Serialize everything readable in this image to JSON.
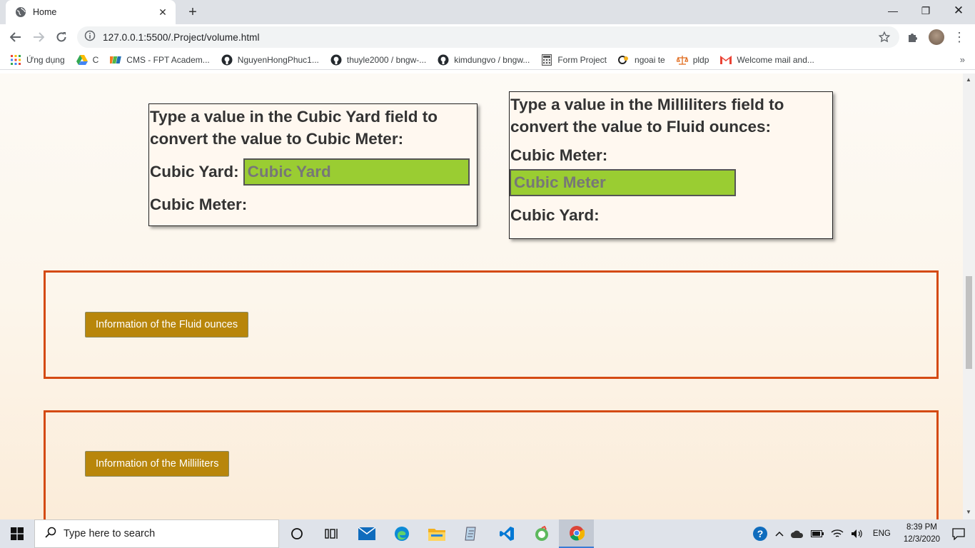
{
  "browser": {
    "tab_title": "Home",
    "url": "127.0.0.1:5500/.Project/volume.html",
    "bookmarks": [
      {
        "label": "Ứng dụng",
        "icon": "apps-grid-icon"
      },
      {
        "label": "C",
        "icon": "google-drive-icon"
      },
      {
        "label": "CMS - FPT Academ...",
        "icon": "fpt-icon"
      },
      {
        "label": "NguyenHongPhuc1...",
        "icon": "github-icon"
      },
      {
        "label": "thuyle2000 / bngw-...",
        "icon": "github-icon"
      },
      {
        "label": "kimdungvo / bngw...",
        "icon": "github-icon"
      },
      {
        "label": "Form Project",
        "icon": "calculator-icon"
      },
      {
        "label": "ngoai te",
        "icon": "currency-icon"
      },
      {
        "label": "pldp",
        "icon": "scale-icon"
      },
      {
        "label": "Welcome mail and...",
        "icon": "gmail-icon"
      }
    ]
  },
  "page": {
    "yard_box": {
      "instruction": "Type a value in the Cubic Yard field to convert the value to Cubic Meter:",
      "input_label": "Cubic Yard:",
      "input_placeholder": "Cubic Yard",
      "output_label": "Cubic Meter:"
    },
    "ml_box": {
      "instruction": "Type a value in the Milliliters field to convert the value to Fluid ounces:",
      "input_label": "Cubic Meter:",
      "input_placeholder": "Cubic Meter",
      "output_label": "Cubic Yard:"
    },
    "info_fluid_button": "Information of the Fluid ounces",
    "info_ml_button": "Information of the Milliliters"
  },
  "taskbar": {
    "search_placeholder": "Type here to search",
    "language": "ENG",
    "time": "8:39 PM",
    "date": "12/3/2020"
  },
  "colors": {
    "input_bg": "#9acd32",
    "panel_border": "#d44a14",
    "info_button_bg": "#b8860b"
  }
}
